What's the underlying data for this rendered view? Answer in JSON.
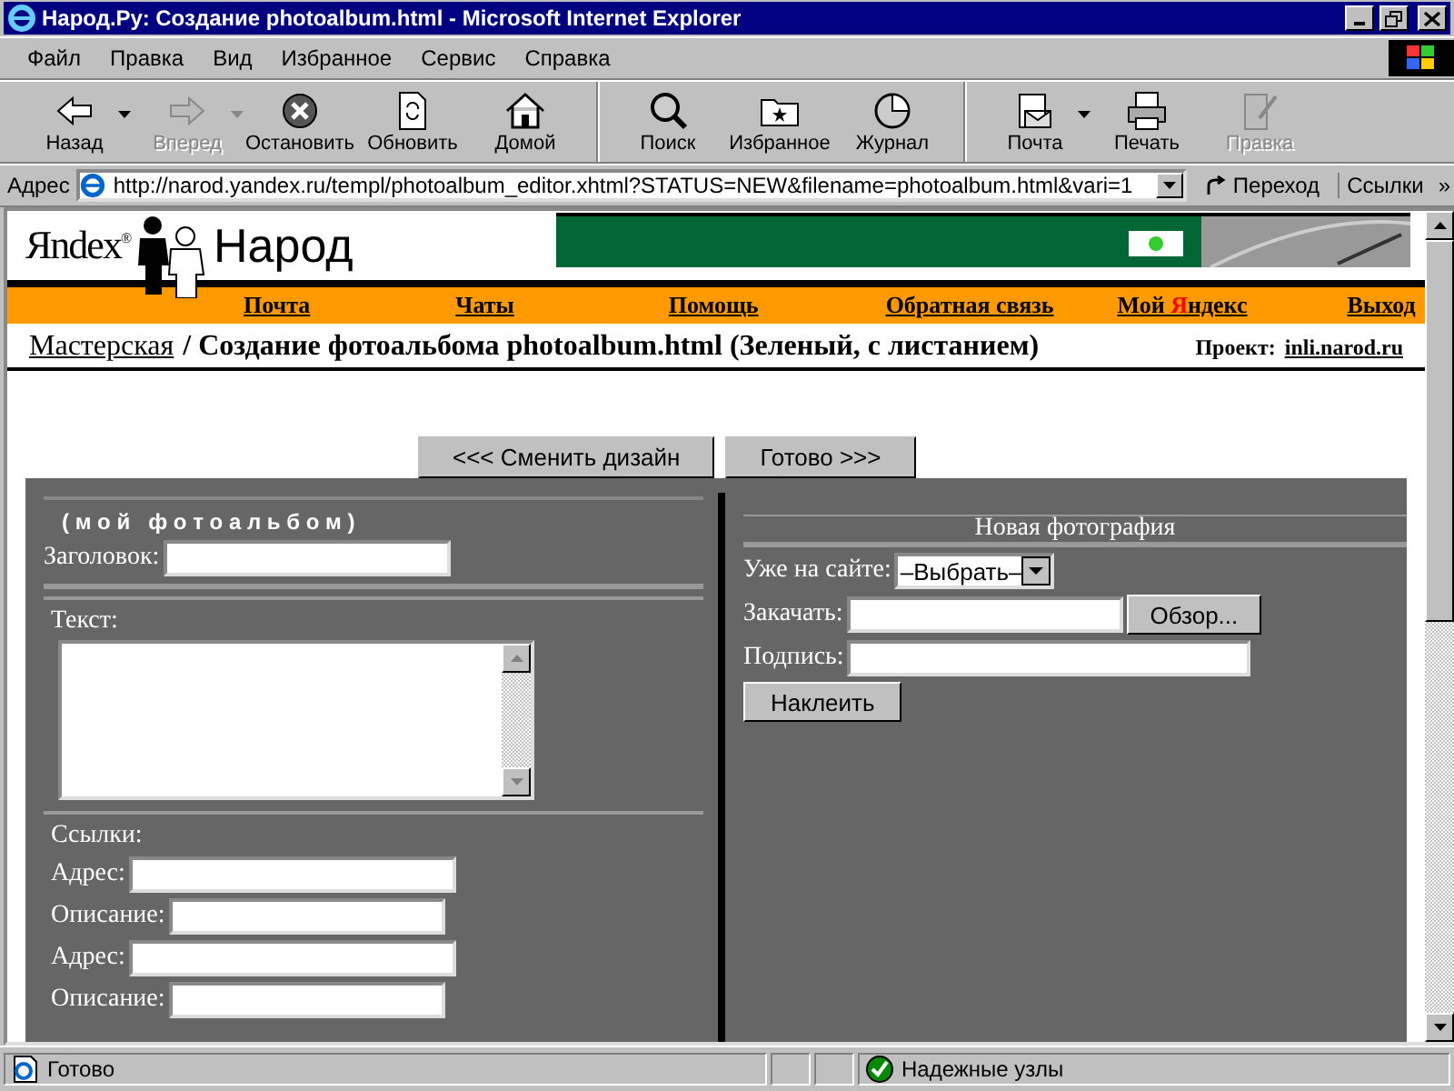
{
  "window": {
    "title": "Народ.Ру: Создание photoalbum.html - Microsoft Internet Explorer"
  },
  "menu": [
    "Файл",
    "Правка",
    "Вид",
    "Избранное",
    "Сервис",
    "Справка"
  ],
  "toolbar": [
    {
      "kind": "back",
      "label": "Назад",
      "disabled": false,
      "dropdown": true,
      "separator_before": false
    },
    {
      "kind": "forward",
      "label": "Вперед",
      "disabled": true,
      "dropdown": true,
      "separator_before": false
    },
    {
      "kind": "stop",
      "label": "Остановить",
      "disabled": false,
      "dropdown": false,
      "separator_before": false
    },
    {
      "kind": "refresh",
      "label": "Обновить",
      "disabled": false,
      "dropdown": false,
      "separator_before": false
    },
    {
      "kind": "home",
      "label": "Домой",
      "disabled": false,
      "dropdown": false,
      "separator_before": false
    },
    {
      "kind": "search",
      "label": "Поиск",
      "disabled": false,
      "dropdown": false,
      "separator_before": true
    },
    {
      "kind": "favorites",
      "label": "Избранное",
      "disabled": false,
      "dropdown": false,
      "separator_before": false
    },
    {
      "kind": "history",
      "label": "Журнал",
      "disabled": false,
      "dropdown": false,
      "separator_before": false
    },
    {
      "kind": "mail",
      "label": "Почта",
      "disabled": false,
      "dropdown": true,
      "separator_before": true
    },
    {
      "kind": "print",
      "label": "Печать",
      "disabled": false,
      "dropdown": false,
      "separator_before": false
    },
    {
      "kind": "edit",
      "label": "Правка",
      "disabled": true,
      "dropdown": false,
      "separator_before": false
    }
  ],
  "address_bar": {
    "label": "Адрес",
    "value": "http://narod.yandex.ru/templ/photoalbum_editor.xhtml?STATUS=NEW&filename=photoalbum.html&vari=1",
    "go": "Переход",
    "links": "Ссылки",
    "more": "»"
  },
  "site_header": {
    "logo": "Яndex$^{®}$",
    "brand": "Народ"
  },
  "nav": [
    {
      "parts": [
        {
          "text": "Почта"
        }
      ]
    },
    {
      "parts": [
        {
          "text": "Чаты"
        }
      ]
    },
    {
      "parts": [
        {
          "text": "Помощь"
        }
      ]
    },
    {
      "parts": [
        {
          "text": "Обратная связь"
        }
      ]
    },
    {
      "parts": [
        {
          "text": "Мой "
        },
        {
          "text": "Я",
          "color": "#ff0000"
        },
        {
          "text": "ндекс"
        }
      ]
    },
    {
      "parts": [
        {
          "text": "Выход"
        }
      ]
    }
  ],
  "breadcrumb": {
    "link": "Мастерская",
    "title": "/ Создание фотоальбома photoalbum.html (Зеленый, с листанием)",
    "project_label": "Проект:",
    "project_link": "inli.narod.ru"
  },
  "buttons": [
    "<<< Сменить дизайн",
    "Готово >>>"
  ],
  "editor": {
    "heading": "( м о й   ф о т о а л ь б о м )",
    "title_label": "Заголовок:",
    "text_label": "Текст:",
    "links_label": "Ссылки:",
    "links": [
      {
        "label": "Адрес:"
      },
      {
        "label": "Описание:"
      },
      {
        "label": "Адрес:"
      },
      {
        "label": "Описание:"
      }
    ],
    "photo": {
      "heading": "Новая фотография",
      "existing_label": "Уже на сайте:",
      "existing_value": "–Выбрать–",
      "upload_label": "Закачать:",
      "browse": "Обзор...",
      "caption_label": "Подпись:",
      "paste": "Наклеить"
    }
  },
  "status_bar": {
    "text": "Готово",
    "zone": "Надежные узлы"
  }
}
